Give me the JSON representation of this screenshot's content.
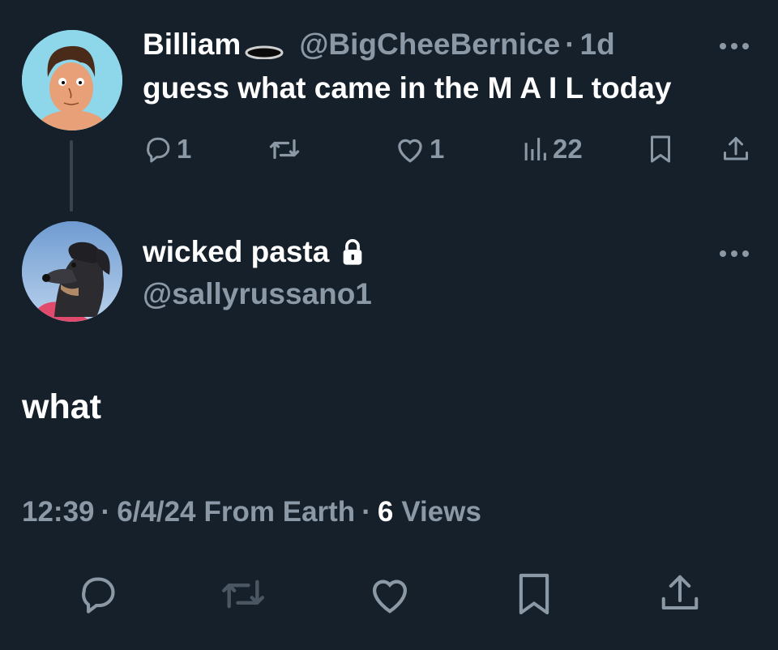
{
  "parent_tweet": {
    "display_name": "Billiam",
    "emoji": "hole-emoji",
    "handle": "@BigCheeBernice",
    "separator": "·",
    "time_ago": "1d",
    "text": "guess what came in the M A I L today",
    "actions": {
      "reply_icon": "reply-icon",
      "reply_count": "1",
      "retweet_icon": "retweet-icon",
      "like_icon": "heart-icon",
      "like_count": "1",
      "views_icon": "views-icon",
      "views_count": "22",
      "bookmark_icon": "bookmark-icon",
      "share_icon": "share-icon"
    },
    "avatar_colors": {
      "bg": "#8ed6ea",
      "skin": "#e7a077"
    }
  },
  "main_tweet": {
    "display_name": "wicked pasta",
    "lock_icon": "lock-icon",
    "handle": "@sallyrussano1",
    "text": "what",
    "meta": {
      "time": "12:39",
      "sep1": "·",
      "date": "6/4/24",
      "source": "From Earth",
      "sep2": "·",
      "views_count": "6",
      "views_label": "Views"
    },
    "actions": [
      "reply-icon",
      "retweet-icon",
      "heart-icon",
      "bookmark-icon",
      "share-icon"
    ]
  },
  "colors": {
    "background": "#15202b",
    "text": "#ffffff",
    "secondary": "#8b98a5",
    "thread_line": "#38444d"
  }
}
